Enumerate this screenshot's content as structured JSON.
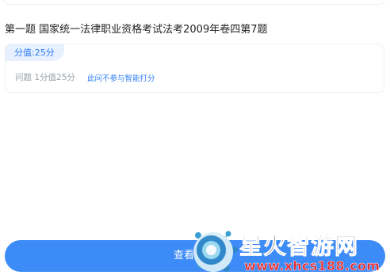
{
  "question": {
    "title": "第一题  国家统一法律职业资格考试法考2009年卷四第7题"
  },
  "score_card": {
    "badge": "分值:25分",
    "meta": "问题 1分值25分",
    "ai_note": "此问不参与智能打分"
  },
  "footer": {
    "button_label": "查看"
  },
  "watermark": {
    "brand": "星火智游网",
    "url": "www.xhcs188.com"
  },
  "colors": {
    "accent": "#3d8bf7",
    "badge_bg": "#e7f0ff",
    "link_blue": "#2e7cf6",
    "watermark_red": "#e8282b"
  }
}
